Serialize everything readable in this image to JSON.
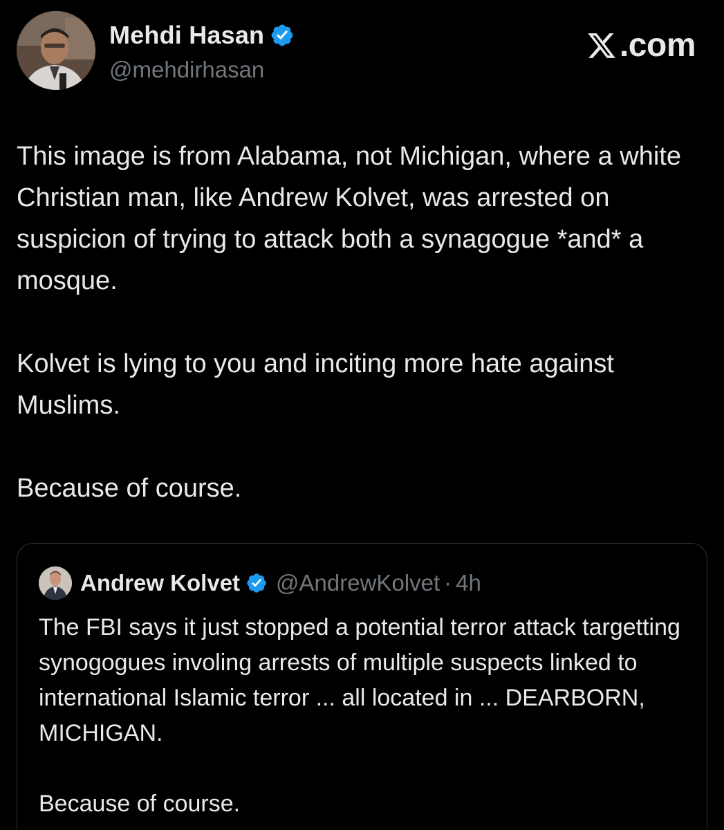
{
  "brand": {
    "label": ".com",
    "icon": "x-logo-icon"
  },
  "author": {
    "name": "Mehdi Hasan",
    "handle": "@mehdirhasan",
    "verified_icon": "verified-badge-icon",
    "verified_color": "#1d9bf0"
  },
  "tweet": {
    "paragraphs": [
      "This image is from Alabama, not Michigan, where a white Christian man, like Andrew Kolvet, was arrested on suspicion of trying to attack both a synagogue *and* a mosque.",
      "Kolvet is lying to you and inciting more hate against Muslims.",
      "Because of course."
    ]
  },
  "quoted": {
    "name": "Andrew Kolvet",
    "handle": "@AndrewKolvet",
    "separator": "·",
    "time": "4h",
    "paragraphs": [
      "The FBI says it just stopped a potential terror attack targetting synogogues involing arrests of multiple suspects linked to international Islamic terror ... all located in ... DEARBORN, MICHIGAN.",
      "Because of course."
    ]
  },
  "colors": {
    "background": "#000000",
    "text": "#e7e9ea",
    "secondary_text": "#71767b",
    "border": "#2f3336",
    "accent": "#1d9bf0"
  }
}
